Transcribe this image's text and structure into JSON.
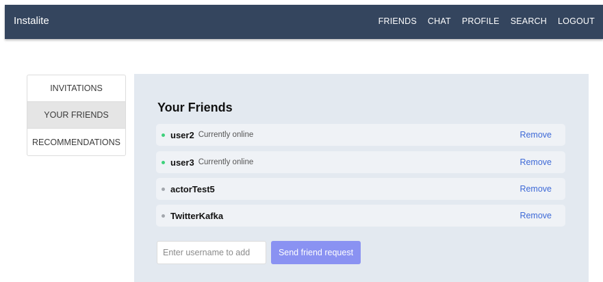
{
  "header": {
    "brand": "Instalite",
    "nav": [
      "FRIENDS",
      "CHAT",
      "PROFILE",
      "SEARCH",
      "LOGOUT"
    ]
  },
  "sidebar": {
    "tabs": [
      {
        "label": "INVITATIONS",
        "active": false
      },
      {
        "label": "YOUR FRIENDS",
        "active": true
      },
      {
        "label": "RECOMMENDATIONS",
        "active": false
      }
    ]
  },
  "main": {
    "title": "Your Friends",
    "friends": [
      {
        "name": "user2",
        "status": "Currently online",
        "online": true,
        "action": "Remove"
      },
      {
        "name": "user3",
        "status": "Currently online",
        "online": true,
        "action": "Remove"
      },
      {
        "name": "actorTest5",
        "status": "",
        "online": false,
        "action": "Remove"
      },
      {
        "name": "TwitterKafka",
        "status": "",
        "online": false,
        "action": "Remove"
      }
    ],
    "add_input": {
      "value": "",
      "placeholder": "Enter username to add"
    },
    "send_button": "Send friend request"
  },
  "colors": {
    "header_bg": "#34455e",
    "panel_bg": "#e3e9f0",
    "online_dot": "#3ed17b",
    "offline_dot": "#a3a7ad",
    "link": "#3d69d7",
    "button": "#8a92f2"
  }
}
